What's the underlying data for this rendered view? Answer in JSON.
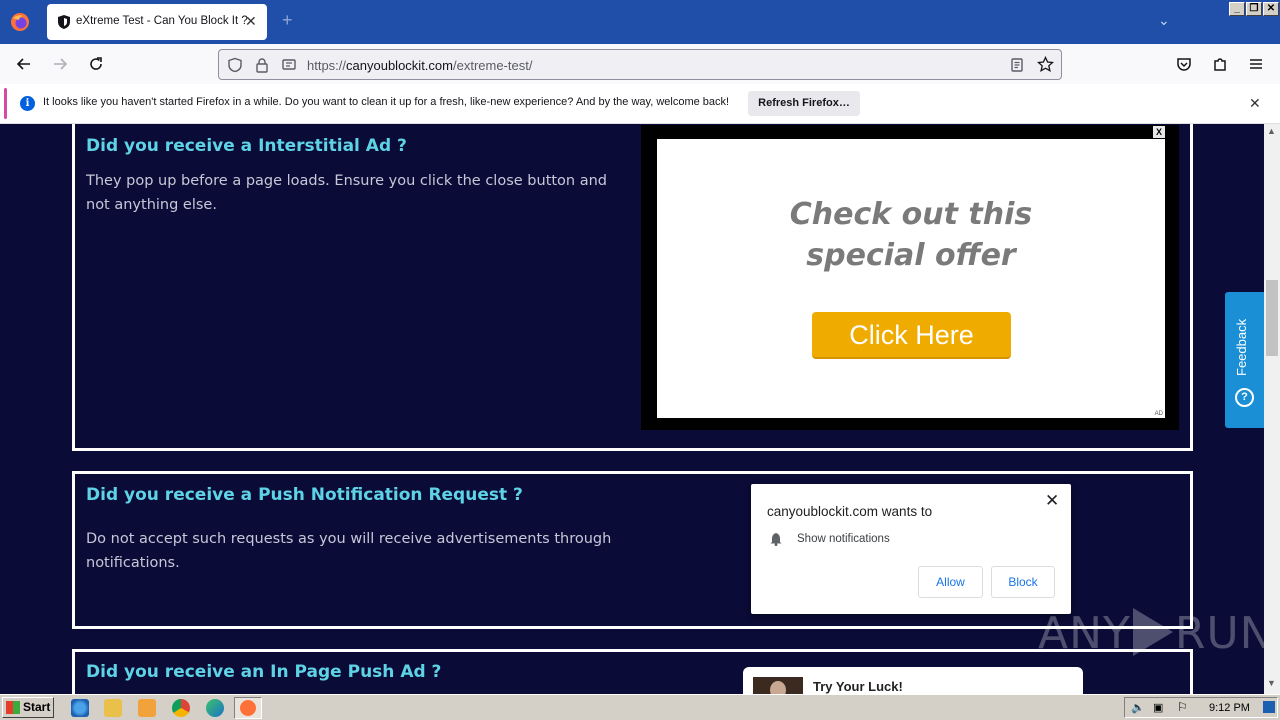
{
  "browser": {
    "tab_title": "eXtreme Test - Can You Block It ?",
    "tab_close": "✕",
    "new_tab": "+",
    "url_domain": "canyoublockit.com",
    "url_prefix": "https://",
    "url_path": "/extreme-test/"
  },
  "notification_bar": {
    "message": "It looks like you haven't started Firefox in a while. Do you want to clean it up for a fresh, like-new experience? And by the way, welcome back!",
    "button": "Refresh Firefox…",
    "info_glyph": "i",
    "close": "✕"
  },
  "sections": [
    {
      "heading": "Did you receive a Interstitial Ad ?",
      "text": "They pop up before a page loads. Ensure you click the close button and not anything else."
    },
    {
      "heading": "Did you receive a Push Notification Request ?",
      "text": "Do not accept such requests as you will receive advertisements through notifications."
    },
    {
      "heading": "Did you receive an In Page Push Ad ?"
    }
  ],
  "interstitial_ad": {
    "headline_line1": "Check out this",
    "headline_line2": "special offer",
    "cta": "Click Here",
    "close": "X",
    "tag": "AD"
  },
  "push_dialog": {
    "title": "canyoublockit.com wants to",
    "permission": "Show notifications",
    "allow": "Allow",
    "block": "Block",
    "close": "✕"
  },
  "inpage_ad": {
    "title": "Try Your Luck!"
  },
  "feedback": {
    "label": "Feedback"
  },
  "watermark": {
    "left": "ANY",
    "right": "RUN"
  },
  "taskbar": {
    "start": "Start",
    "clock": "9:12 PM"
  },
  "colors": {
    "page_bg": "#0a0b36",
    "heading": "#5fd3e6",
    "cta": "#f0ab00",
    "feedback": "#1a8fd6"
  }
}
